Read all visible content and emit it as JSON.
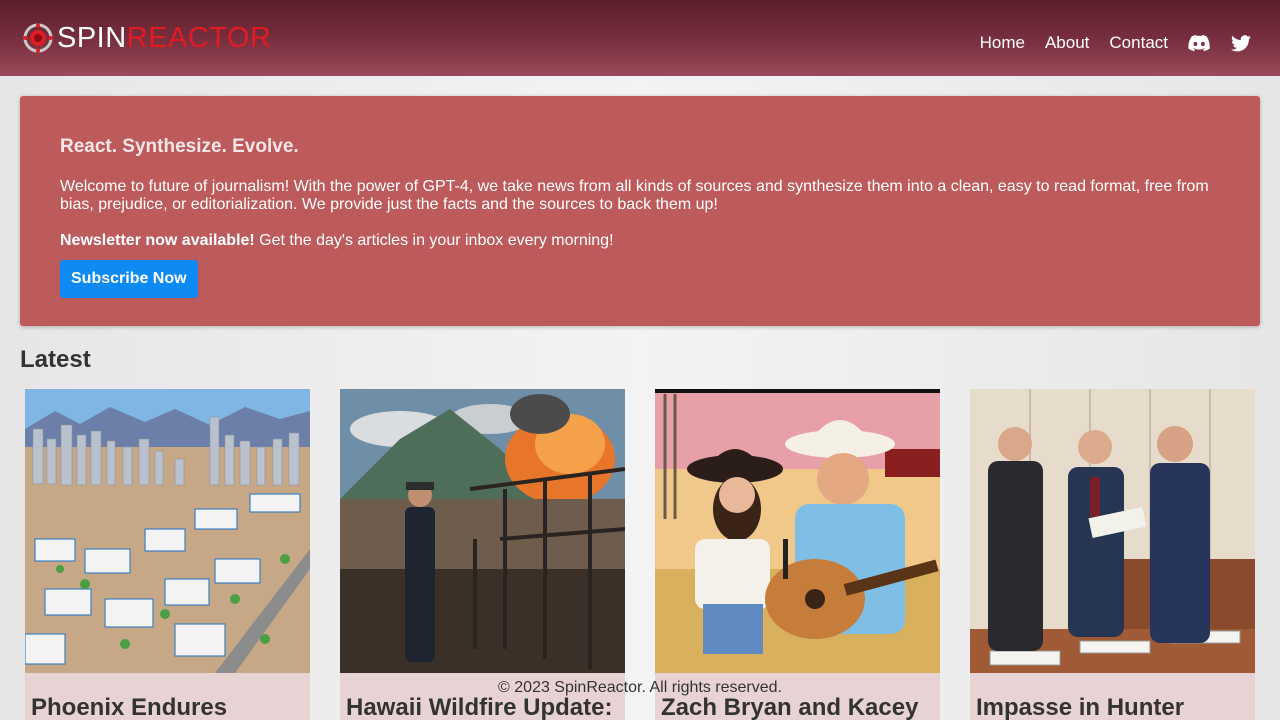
{
  "header": {
    "logo_spin": "SPIN",
    "logo_reactor": "REACTOR",
    "nav": [
      {
        "label": "Home"
      },
      {
        "label": "About"
      },
      {
        "label": "Contact"
      }
    ],
    "icons": [
      "discord-icon",
      "twitter-icon"
    ]
  },
  "hero": {
    "tagline": "React. Synthesize. Evolve.",
    "intro": "Welcome to future of journalism! With the power of GPT-4, we take news from all kinds of sources and synthesize them into a clean, easy to read format, free from bias, prejudice, or editorialization. We provide just the facts and the sources to back them up!",
    "newsletter_bold": "Newsletter now available!",
    "newsletter_text": " Get the day's articles in your inbox every morning!",
    "subscribe_label": "Subscribe Now"
  },
  "latest": {
    "heading": "Latest",
    "articles": [
      {
        "title": "Phoenix Endures"
      },
      {
        "title": "Hawaii Wildfire Update:"
      },
      {
        "title": "Zach Bryan and Kacey"
      },
      {
        "title": "Impasse in Hunter"
      }
    ]
  },
  "footer": {
    "text": "© 2023 SpinReactor. All rights reserved."
  },
  "colors": {
    "header_dark": "#5a1d2a",
    "hero_bg": "#bd5b5c",
    "button_bg": "#0d8bf3",
    "logo_red": "#e11b22",
    "card_bg": "#e8d3d4"
  }
}
